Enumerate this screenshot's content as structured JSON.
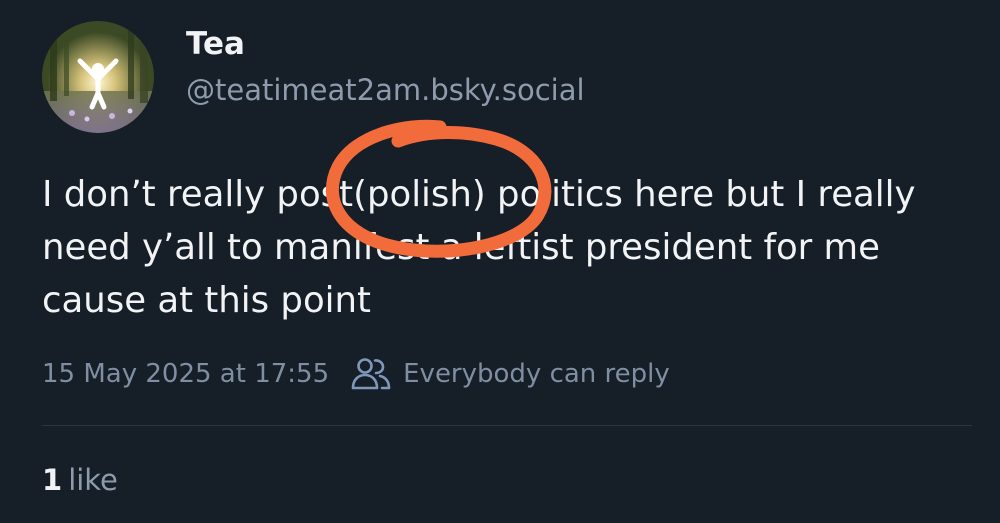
{
  "author": {
    "name": "Tea",
    "handle": "@teatimeat2am.bsky.social"
  },
  "post": {
    "text": "I don’t really post(polish) politics here but I really need y’all to manifest a leftist president for me cause at this point"
  },
  "meta": {
    "timestamp": "15 May 2025 at 17:55",
    "reply_setting": "Everybody can reply",
    "reply_icon": "people-icon"
  },
  "engagement": {
    "likes_count": "1",
    "likes_label": "like"
  },
  "colors": {
    "background": "#161e27",
    "text_primary": "#f1f3f5",
    "text_secondary": "#8d9bad",
    "annotation_stroke": "#f26b3a",
    "icon_accent": "#7f97b8"
  }
}
